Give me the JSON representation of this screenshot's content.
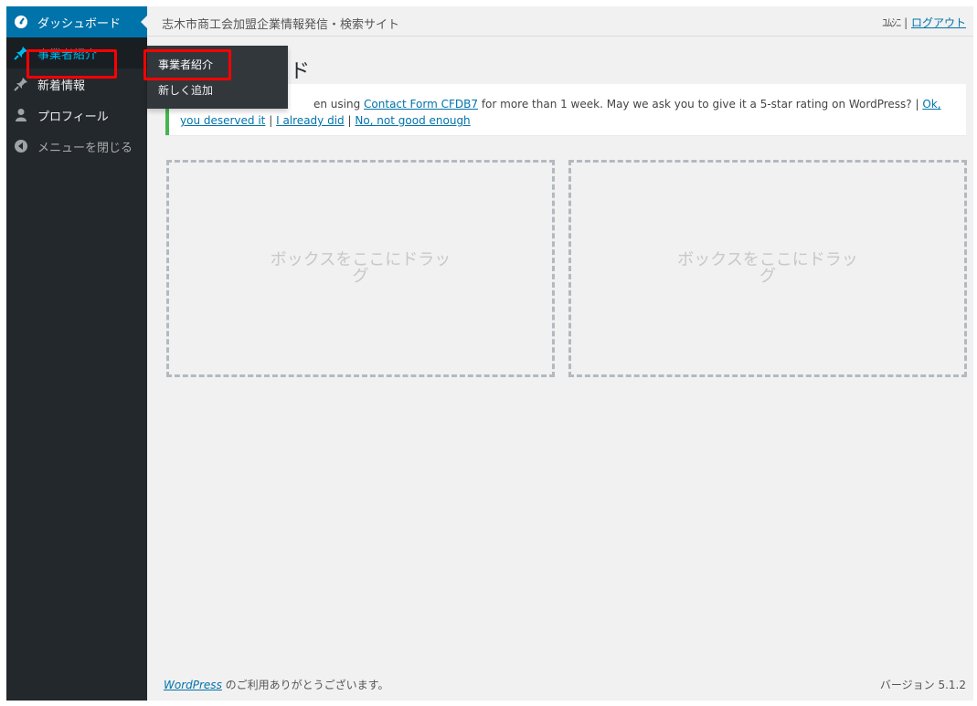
{
  "header": {
    "site_title": "志木市商工会加盟企業情報発信・検索サイト",
    "user_name": "ﾕﾑｼﾆ",
    "separator": "|",
    "logout_label": "ログアウト"
  },
  "sidebar": {
    "items": [
      {
        "label": "ダッシュボード",
        "icon": "dashboard-icon"
      },
      {
        "label": "事業者紹介",
        "icon": "pushpin-icon"
      },
      {
        "label": "新着情報",
        "icon": "pushpin-icon"
      },
      {
        "label": "プロフィール",
        "icon": "user-icon"
      },
      {
        "label": "メニューを閉じる",
        "icon": "collapse-icon"
      }
    ]
  },
  "flyout": {
    "items": [
      {
        "label": "事業者紹介"
      },
      {
        "label": "新しく追加"
      }
    ]
  },
  "main": {
    "heading_visible": "ド",
    "notice": {
      "text_1": "en using",
      "link_plugin": "Contact Form CFDB7",
      "text_2": "for more than 1 week. May we ask you to give it a 5-star rating on WordPress? |",
      "link_ok": "Ok, you deserved it",
      "text_sep": "|",
      "link_already": "I already did",
      "link_no": "No, not good enough"
    },
    "dropzone_left": "ボックスをここにドラッグ",
    "dropzone_right": "ボックスをここにドラッグ"
  },
  "footer": {
    "wp_link": "WordPress",
    "thanks": " のご利用ありがとうございます。",
    "version": "バージョン 5.1.2"
  },
  "colors": {
    "sidebar_bg": "#23282d",
    "accent": "#0073aa",
    "highlight": "#ff0000",
    "notice_border": "#46b450"
  }
}
